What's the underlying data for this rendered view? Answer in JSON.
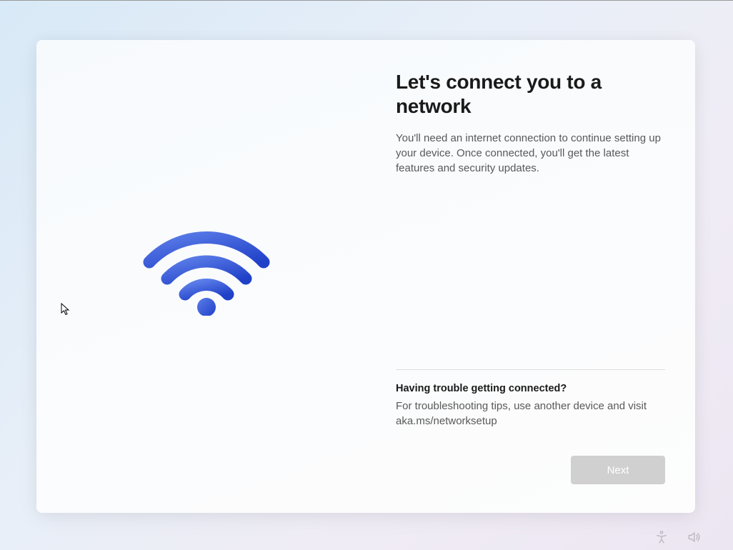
{
  "main": {
    "title": "Let's connect you to a network",
    "description": "You'll need an internet connection to continue setting up your device. Once connected, you'll get the latest features and security updates.",
    "trouble_heading": "Having trouble getting connected?",
    "trouble_text": "For troubleshooting tips, use another device and visit aka.ms/networksetup",
    "next_label": "Next"
  }
}
